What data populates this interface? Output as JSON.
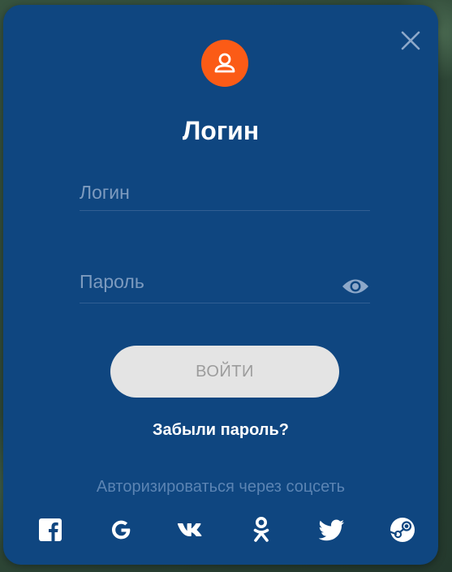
{
  "dialog": {
    "title": "Логин",
    "login_placeholder": "Логин",
    "password_placeholder": "Пароль",
    "submit_label": "ВОЙТИ",
    "forgot_link": "Забыли пароль?",
    "social_caption": "Авторизироваться через соцсеть"
  },
  "social": [
    {
      "name": "facebook",
      "icon": "facebook-icon"
    },
    {
      "name": "google",
      "icon": "google-icon"
    },
    {
      "name": "vk",
      "icon": "vk-icon"
    },
    {
      "name": "odnoklassniki",
      "icon": "odnoklassniki-icon"
    },
    {
      "name": "twitter",
      "icon": "twitter-icon"
    },
    {
      "name": "steam",
      "icon": "steam-icon"
    }
  ],
  "colors": {
    "dialog_bg": "#0f4680",
    "avatar_bg": "#fb5b16",
    "button_bg": "#e4e4e4",
    "button_text": "#9c9c9c",
    "muted_text": "#7d9bbf"
  }
}
